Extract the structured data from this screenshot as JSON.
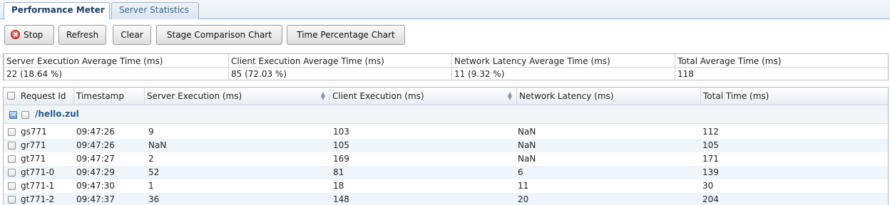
{
  "tabs": [
    {
      "label": "Performance Meter",
      "active": true
    },
    {
      "label": "Server Statistics",
      "active": false
    }
  ],
  "toolbar": {
    "stop": "Stop",
    "refresh": "Refresh",
    "clear": "Clear",
    "stage_chart": "Stage Comparison Chart",
    "time_chart": "Time Percentage Chart"
  },
  "summary": {
    "headers": [
      "Server Execution Average Time (ms)",
      "Client Execution Average Time (ms)",
      "Network Latency Average Time (ms)",
      "Total Average Time (ms)"
    ],
    "values": [
      "22 (18.64 %)",
      "85 (72.03 %)",
      "11 (9.32 %)",
      "118"
    ]
  },
  "grid": {
    "columns": [
      "Request Id",
      "Timestamp",
      "Server Execution (ms)",
      "Client Execution (ms)",
      "Network Latency (ms)",
      "Total Time (ms)"
    ],
    "group": "/hello.zul",
    "rows": [
      [
        "gs771",
        "09:47:26",
        "9",
        "103",
        "NaN",
        "112"
      ],
      [
        "gr771",
        "09:47:26",
        "NaN",
        "105",
        "NaN",
        "105"
      ],
      [
        "gt771",
        "09:47:27",
        "2",
        "169",
        "NaN",
        "171"
      ],
      [
        "gt771-0",
        "09:47:29",
        "52",
        "81",
        "6",
        "139"
      ],
      [
        "gt771-1",
        "09:47:30",
        "1",
        "18",
        "11",
        "30"
      ],
      [
        "gt771-2",
        "09:47:37",
        "36",
        "148",
        "20",
        "204"
      ]
    ]
  },
  "colors": {
    "tab_text_active": "#1c3f66",
    "tab_text_inactive": "#3b6894",
    "row_alt": "#eef6fb",
    "stop_red": "#d21f1f"
  }
}
